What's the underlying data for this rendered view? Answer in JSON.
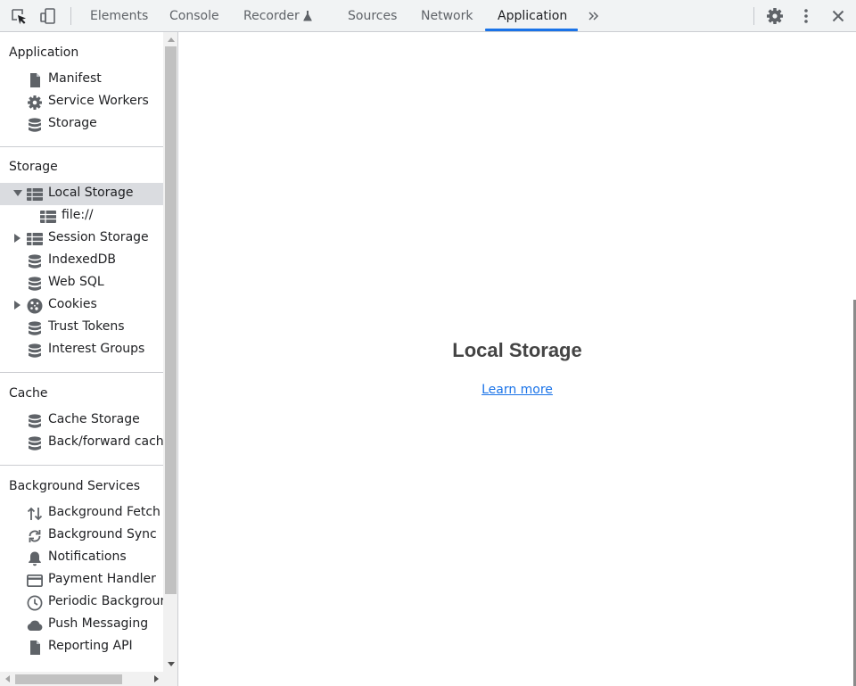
{
  "toolbar": {
    "tabs": [
      {
        "label": "Elements"
      },
      {
        "label": "Console"
      },
      {
        "label": "Recorder"
      },
      {
        "label": "Sources"
      },
      {
        "label": "Network"
      },
      {
        "label": "Application"
      }
    ],
    "active_tab": "Application",
    "icons": [
      "inspect-element-icon",
      "device-toolbar-icon",
      "flask-icon",
      "more-tabs-icon",
      "settings-gear-icon",
      "kebab-menu-icon",
      "close-icon"
    ]
  },
  "sidebar": {
    "sections": [
      {
        "title": "Application",
        "items": [
          {
            "label": "Manifest",
            "icon": "file-icon"
          },
          {
            "label": "Service Workers",
            "icon": "gear-icon"
          },
          {
            "label": "Storage",
            "icon": "database-icon"
          }
        ]
      },
      {
        "title": "Storage",
        "items": [
          {
            "label": "Local Storage",
            "icon": "grid-table-icon",
            "expanded": true,
            "selected": true
          },
          {
            "label": "file://",
            "icon": "grid-table-icon",
            "child": true
          },
          {
            "label": "Session Storage",
            "icon": "grid-table-icon",
            "expanded": false
          },
          {
            "label": "IndexedDB",
            "icon": "database-icon"
          },
          {
            "label": "Web SQL",
            "icon": "database-icon"
          },
          {
            "label": "Cookies",
            "icon": "cookie-icon",
            "expanded": false
          },
          {
            "label": "Trust Tokens",
            "icon": "database-icon"
          },
          {
            "label": "Interest Groups",
            "icon": "database-icon"
          }
        ]
      },
      {
        "title": "Cache",
        "items": [
          {
            "label": "Cache Storage",
            "icon": "database-icon"
          },
          {
            "label": "Back/forward cache",
            "icon": "database-icon"
          }
        ]
      },
      {
        "title": "Background Services",
        "items": [
          {
            "label": "Background Fetch",
            "icon": "up-down-arrows-icon"
          },
          {
            "label": "Background Sync",
            "icon": "sync-icon"
          },
          {
            "label": "Notifications",
            "icon": "bell-icon"
          },
          {
            "label": "Payment Handler",
            "icon": "credit-card-icon"
          },
          {
            "label": "Periodic Background Sync",
            "icon": "clock-icon"
          },
          {
            "label": "Push Messaging",
            "icon": "cloud-icon"
          },
          {
            "label": "Reporting API",
            "icon": "file-icon"
          }
        ]
      }
    ]
  },
  "main": {
    "title": "Local Storage",
    "learn_more": "Learn more"
  },
  "colors": {
    "toolbar_bg": "#f1f3f4",
    "accent": "#1a73e8",
    "selected_row": "#dadce0",
    "icon": "#5f6368"
  }
}
